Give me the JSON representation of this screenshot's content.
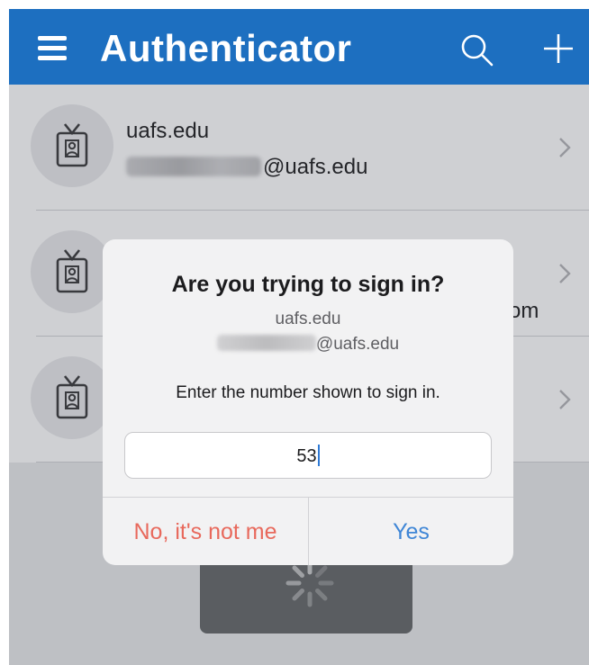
{
  "navbar": {
    "title": "Authenticator",
    "menu_icon": "hamburger-menu-icon",
    "search_icon": "search-icon",
    "add_icon": "plus-icon"
  },
  "accounts": [
    {
      "name": "uafs.edu",
      "email_suffix": "@uafs.edu"
    },
    {
      "name": "",
      "email_suffix": "om"
    },
    {
      "name": "",
      "email_suffix": ""
    }
  ],
  "dialog": {
    "title": "Are you trying to sign in?",
    "domain": "uafs.edu",
    "email_suffix": "@uafs.edu",
    "prompt": "Enter the number shown to sign in.",
    "number_value": "53",
    "deny_label": "No, it's not me",
    "approve_label": "Yes"
  },
  "colors": {
    "navbar": "#1d6fc0",
    "deny": "#e8695c",
    "approve": "#3f86d6"
  }
}
